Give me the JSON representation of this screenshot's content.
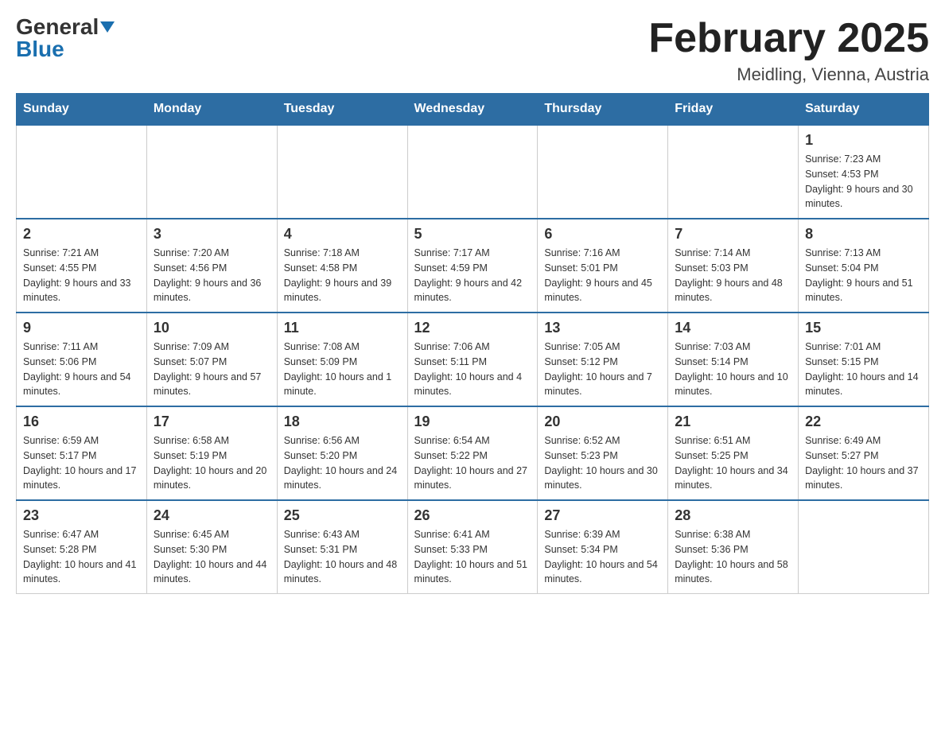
{
  "header": {
    "logo_general": "General",
    "logo_blue": "Blue",
    "title": "February 2025",
    "location": "Meidling, Vienna, Austria"
  },
  "days_of_week": [
    "Sunday",
    "Monday",
    "Tuesday",
    "Wednesday",
    "Thursday",
    "Friday",
    "Saturday"
  ],
  "weeks": [
    [
      {
        "day": "",
        "info": ""
      },
      {
        "day": "",
        "info": ""
      },
      {
        "day": "",
        "info": ""
      },
      {
        "day": "",
        "info": ""
      },
      {
        "day": "",
        "info": ""
      },
      {
        "day": "",
        "info": ""
      },
      {
        "day": "1",
        "info": "Sunrise: 7:23 AM\nSunset: 4:53 PM\nDaylight: 9 hours and 30 minutes."
      }
    ],
    [
      {
        "day": "2",
        "info": "Sunrise: 7:21 AM\nSunset: 4:55 PM\nDaylight: 9 hours and 33 minutes."
      },
      {
        "day": "3",
        "info": "Sunrise: 7:20 AM\nSunset: 4:56 PM\nDaylight: 9 hours and 36 minutes."
      },
      {
        "day": "4",
        "info": "Sunrise: 7:18 AM\nSunset: 4:58 PM\nDaylight: 9 hours and 39 minutes."
      },
      {
        "day": "5",
        "info": "Sunrise: 7:17 AM\nSunset: 4:59 PM\nDaylight: 9 hours and 42 minutes."
      },
      {
        "day": "6",
        "info": "Sunrise: 7:16 AM\nSunset: 5:01 PM\nDaylight: 9 hours and 45 minutes."
      },
      {
        "day": "7",
        "info": "Sunrise: 7:14 AM\nSunset: 5:03 PM\nDaylight: 9 hours and 48 minutes."
      },
      {
        "day": "8",
        "info": "Sunrise: 7:13 AM\nSunset: 5:04 PM\nDaylight: 9 hours and 51 minutes."
      }
    ],
    [
      {
        "day": "9",
        "info": "Sunrise: 7:11 AM\nSunset: 5:06 PM\nDaylight: 9 hours and 54 minutes."
      },
      {
        "day": "10",
        "info": "Sunrise: 7:09 AM\nSunset: 5:07 PM\nDaylight: 9 hours and 57 minutes."
      },
      {
        "day": "11",
        "info": "Sunrise: 7:08 AM\nSunset: 5:09 PM\nDaylight: 10 hours and 1 minute."
      },
      {
        "day": "12",
        "info": "Sunrise: 7:06 AM\nSunset: 5:11 PM\nDaylight: 10 hours and 4 minutes."
      },
      {
        "day": "13",
        "info": "Sunrise: 7:05 AM\nSunset: 5:12 PM\nDaylight: 10 hours and 7 minutes."
      },
      {
        "day": "14",
        "info": "Sunrise: 7:03 AM\nSunset: 5:14 PM\nDaylight: 10 hours and 10 minutes."
      },
      {
        "day": "15",
        "info": "Sunrise: 7:01 AM\nSunset: 5:15 PM\nDaylight: 10 hours and 14 minutes."
      }
    ],
    [
      {
        "day": "16",
        "info": "Sunrise: 6:59 AM\nSunset: 5:17 PM\nDaylight: 10 hours and 17 minutes."
      },
      {
        "day": "17",
        "info": "Sunrise: 6:58 AM\nSunset: 5:19 PM\nDaylight: 10 hours and 20 minutes."
      },
      {
        "day": "18",
        "info": "Sunrise: 6:56 AM\nSunset: 5:20 PM\nDaylight: 10 hours and 24 minutes."
      },
      {
        "day": "19",
        "info": "Sunrise: 6:54 AM\nSunset: 5:22 PM\nDaylight: 10 hours and 27 minutes."
      },
      {
        "day": "20",
        "info": "Sunrise: 6:52 AM\nSunset: 5:23 PM\nDaylight: 10 hours and 30 minutes."
      },
      {
        "day": "21",
        "info": "Sunrise: 6:51 AM\nSunset: 5:25 PM\nDaylight: 10 hours and 34 minutes."
      },
      {
        "day": "22",
        "info": "Sunrise: 6:49 AM\nSunset: 5:27 PM\nDaylight: 10 hours and 37 minutes."
      }
    ],
    [
      {
        "day": "23",
        "info": "Sunrise: 6:47 AM\nSunset: 5:28 PM\nDaylight: 10 hours and 41 minutes."
      },
      {
        "day": "24",
        "info": "Sunrise: 6:45 AM\nSunset: 5:30 PM\nDaylight: 10 hours and 44 minutes."
      },
      {
        "day": "25",
        "info": "Sunrise: 6:43 AM\nSunset: 5:31 PM\nDaylight: 10 hours and 48 minutes."
      },
      {
        "day": "26",
        "info": "Sunrise: 6:41 AM\nSunset: 5:33 PM\nDaylight: 10 hours and 51 minutes."
      },
      {
        "day": "27",
        "info": "Sunrise: 6:39 AM\nSunset: 5:34 PM\nDaylight: 10 hours and 54 minutes."
      },
      {
        "day": "28",
        "info": "Sunrise: 6:38 AM\nSunset: 5:36 PM\nDaylight: 10 hours and 58 minutes."
      },
      {
        "day": "",
        "info": ""
      }
    ]
  ]
}
